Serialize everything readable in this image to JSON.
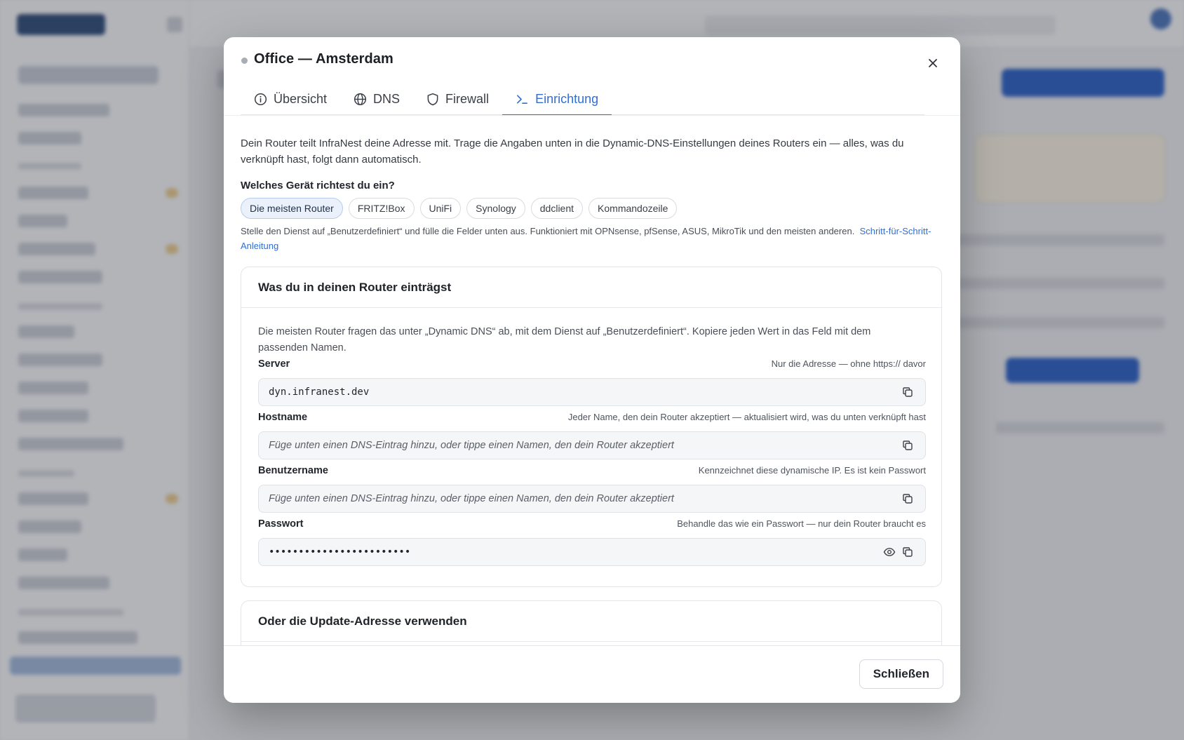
{
  "modal": {
    "title": "Office — Amsterdam",
    "tabs": [
      {
        "label": "Übersicht",
        "icon": "info-icon"
      },
      {
        "label": "DNS",
        "icon": "globe-icon"
      },
      {
        "label": "Firewall",
        "icon": "shield-icon"
      },
      {
        "label": "Einrichtung",
        "icon": "terminal-icon",
        "active": true
      }
    ],
    "intro": "Dein Router teilt InfraNest deine Adresse mit. Trage die Angaben unten in die Dynamic-DNS-Einstellungen deines Routers ein — alles, was du verknüpft hast, folgt dann automatisch.",
    "device_question": "Welches Gerät richtest du ein?",
    "device_options": [
      "Die meisten Router",
      "FRITZ!Box",
      "UniFi",
      "Synology",
      "ddclient",
      "Kommandozeile"
    ],
    "device_selected": "Die meisten Router",
    "hint_text": "Stelle den Dienst auf „Benutzerdefiniert“ und fülle die Felder unten aus. Funktioniert mit OPNsense, pfSense, ASUS, MikroTik und den meisten anderen.",
    "hint_link": "Schritt-für-Schritt-Anleitung",
    "router_section": {
      "title": "Was du in deinen Router einträgst",
      "description": "Die meisten Router fragen das unter „Dynamic DNS“ ab, mit dem Dienst auf „Benutzerdefiniert“. Kopiere jeden Wert in das Feld mit dem passenden Namen.",
      "fields": {
        "server": {
          "label": "Server",
          "help": "Nur die Adresse — ohne https:// davor",
          "value": "dyn.infranest.dev"
        },
        "hostname": {
          "label": "Hostname",
          "help": "Jeder Name, den dein Router akzeptiert — aktualisiert wird, was du unten verknüpft hast",
          "placeholder": "Füge unten einen DNS-Eintrag hinzu, oder tippe einen Namen, den dein Router akzeptiert"
        },
        "username": {
          "label": "Benutzername",
          "help": "Kennzeichnet diese dynamische IP. Es ist kein Passwort",
          "placeholder": "Füge unten einen DNS-Eintrag hinzu, oder tippe einen Namen, den dein Router akzeptiert"
        },
        "password": {
          "label": "Passwort",
          "help": "Behandle das wie ein Passwort — nur dein Router braucht es",
          "value": "••••••••••••••••••••••••"
        }
      }
    },
    "update_section": {
      "title": "Oder die Update-Adresse verwenden"
    },
    "footer": {
      "close_label": "Schließen"
    }
  }
}
